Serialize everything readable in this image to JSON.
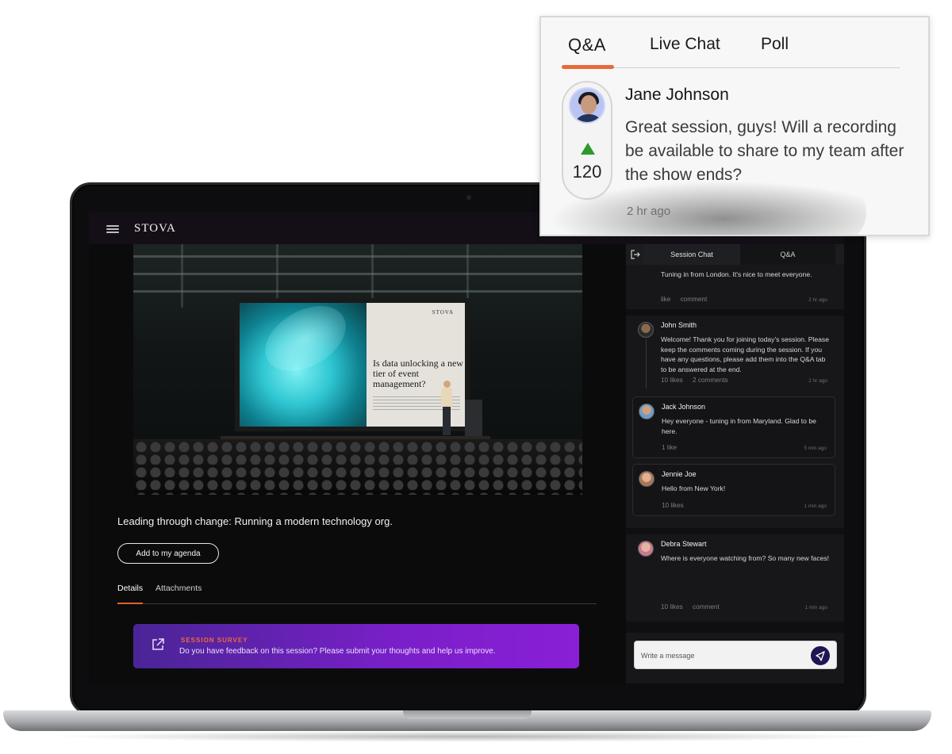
{
  "app": {
    "logo": "STOVA"
  },
  "hero": {
    "screen_logo": "STOVA",
    "screen_headline": "Is data unlocking a new tier of event management?"
  },
  "session": {
    "title": "Leading through change: Running a modern technology org.",
    "agenda_button": "Add to my agenda",
    "tabs": [
      {
        "label": "Details",
        "active": true
      },
      {
        "label": "Attachments",
        "active": false
      }
    ],
    "survey": {
      "label": "SESSION SURVEY",
      "text": "Do you have feedback on this session? Please submit your thoughts and help us improve."
    }
  },
  "chat": {
    "tabs": [
      {
        "label": "Session Chat",
        "active": true
      },
      {
        "label": "Q&A",
        "active": false
      }
    ],
    "messages": [
      {
        "name": "",
        "body": "Tuning in from London. It's nice to meet everyone.",
        "likes": "like",
        "comments": "comment",
        "time": "2 hr ago"
      },
      {
        "name": "John Smith",
        "body": "Welcome! Thank you for joining today's session. Please keep the comments coming during the session. If you have any questions, please add them into the Q&A tab to be answered at the end.",
        "likes": "10 likes",
        "comments": "2 comments",
        "time": "2 hr ago"
      },
      {
        "name": "Jack Johnson",
        "body": "Hey everyone - tuning in from Maryland. Glad to be here.",
        "likes": "1 like",
        "comments": "",
        "time": "5 min ago"
      },
      {
        "name": "Jennie Joe",
        "body": "Hello from New York!",
        "likes": "10 likes",
        "comments": "",
        "time": "1 min ago"
      },
      {
        "name": "Debra Stewart",
        "body": "Where is everyone watching from? So many new faces!",
        "likes": "10 likes",
        "comments": "comment",
        "time": "1 min ago"
      }
    ],
    "input_placeholder": "Write a message"
  },
  "qa_card": {
    "tabs": [
      {
        "label": "Q&A",
        "active": true
      },
      {
        "label": "Live Chat",
        "active": false
      },
      {
        "label": "Poll",
        "active": false
      }
    ],
    "question": {
      "name": "Jane Johnson",
      "votes": "120",
      "text": "Great session, guys! Will a recording be available to share to my team after the show ends?",
      "time": "2 hr ago"
    }
  },
  "colors": {
    "accent_orange": "#e66a3a",
    "survey_gradient_start": "#4a2596",
    "survey_gradient_end": "#8a1fd6",
    "upvote_green": "#2c9a2c",
    "send_button": "#1e1552"
  }
}
